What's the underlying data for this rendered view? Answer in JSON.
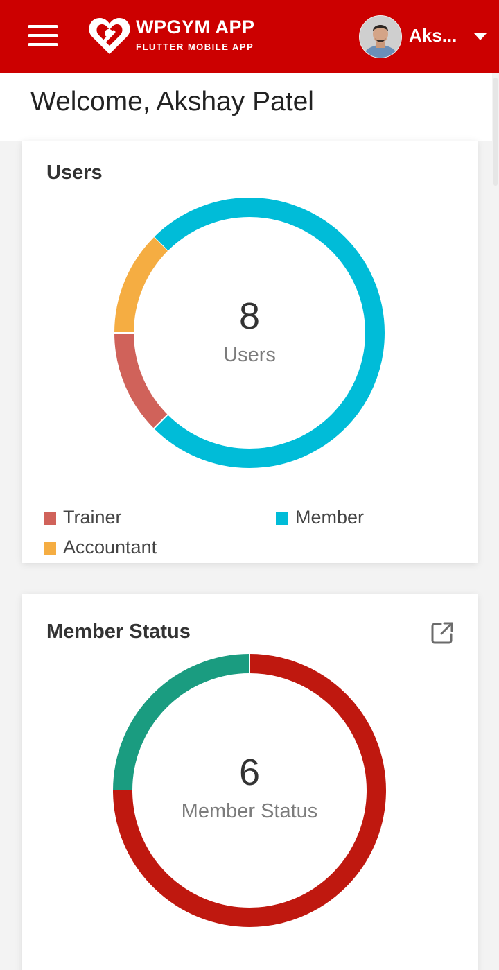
{
  "header": {
    "logo": {
      "title": "WPGYM APP",
      "subtitle": "FLUTTER MOBILE APP",
      "icon": "heart-logo-icon"
    },
    "menu_icon": "hamburger-menu-icon",
    "user": {
      "name": "Aks...",
      "avatar": "user-avatar",
      "caret_icon": "caret-down-icon"
    },
    "color": "#cc0000"
  },
  "welcome": {
    "text": "Welcome, Akshay Patel"
  },
  "users_card": {
    "title": "Users",
    "center_value": "8",
    "center_label": "Users",
    "legend": [
      {
        "label": "Trainer",
        "color": "#d0625a"
      },
      {
        "label": "Member",
        "color": "#00bcd8"
      },
      {
        "label": "Accountant",
        "color": "#f5ad42"
      }
    ]
  },
  "status_card": {
    "title": "Member Status",
    "center_value": "6",
    "center_label": "Member Status",
    "open_icon": "open-in-new-icon",
    "segment_colors": [
      "#1a9c80",
      "#bf180f"
    ]
  },
  "chart_data": [
    {
      "type": "pie",
      "variant": "donut",
      "title": "Users",
      "total": 8,
      "categories": [
        "Member",
        "Trainer",
        "Accountant"
      ],
      "values": [
        6,
        1,
        1
      ],
      "colors": [
        "#00bcd8",
        "#d0625a",
        "#f5ad42"
      ]
    },
    {
      "type": "pie",
      "variant": "donut",
      "title": "Member Status",
      "total": 6,
      "categories": [
        "",
        ""
      ],
      "values": [
        1.5,
        4.5
      ],
      "colors": [
        "#1a9c80",
        "#bf180f"
      ]
    }
  ]
}
